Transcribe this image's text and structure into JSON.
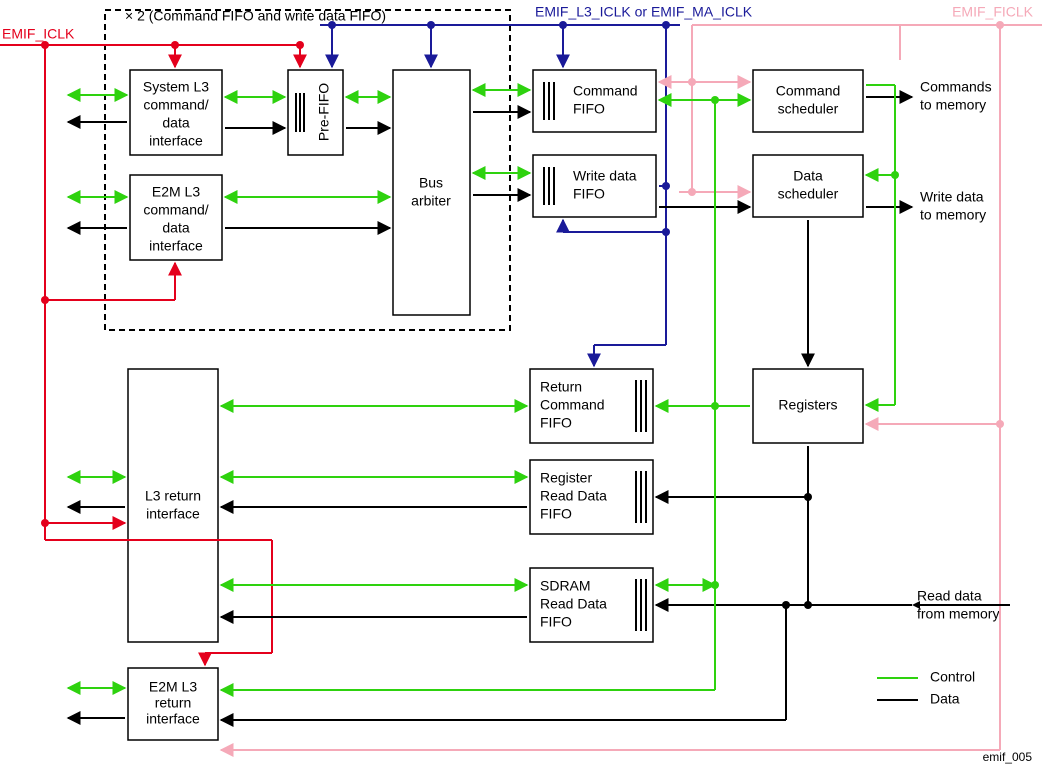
{
  "clocks": {
    "emif_iclk": "EMIF_ICLK",
    "emif_l3_iclk": "EMIF_L3_ICLK or EMIF_MA_ICLK",
    "emif_ficlk": "EMIF_FICLK"
  },
  "dashbox_label": "× 2 (Command FIFO and write data FIFO)",
  "blocks": {
    "sys_l3": {
      "l1": "System L3",
      "l2": "command/",
      "l3": "data",
      "l4": "interface"
    },
    "e2m_l3": {
      "l1": "E2M L3",
      "l2": "command/",
      "l3": "data",
      "l4": "interface"
    },
    "pre_fifo": "Pre-FIFO",
    "bus_arbiter": {
      "l1": "Bus",
      "l2": "arbiter"
    },
    "cmd_fifo": {
      "l1": "Command",
      "l2": "FIFO"
    },
    "wr_fifo": {
      "l1": "Write data",
      "l2": "FIFO"
    },
    "ret_cmd_fifo": {
      "l1": "Return",
      "l2": "Command",
      "l3": "FIFO"
    },
    "reg_rd_fifo": {
      "l1": "Register",
      "l2": "Read Data",
      "l3": "FIFO"
    },
    "sdram_rd_fifo": {
      "l1": "SDRAM",
      "l2": "Read Data",
      "l3": "FIFO"
    },
    "l3_return": {
      "l1": "L3 return",
      "l2": "interface"
    },
    "e2m_return": {
      "l1": "E2M L3",
      "l2": "return",
      "l3": "interface"
    },
    "cmd_sched": {
      "l1": "Command",
      "l2": "scheduler"
    },
    "data_sched": {
      "l1": "Data",
      "l2": "scheduler"
    },
    "registers": "Registers"
  },
  "io": {
    "cmds_to_mem": {
      "l1": "Commands",
      "l2": "to memory"
    },
    "wd_to_mem": {
      "l1": "Write data",
      "l2": "to memory"
    },
    "rd_from_mem": {
      "l1": "Read data",
      "l2": "from memory"
    }
  },
  "legend": {
    "control": "Control",
    "data": "Data"
  },
  "footer_id": "emif_005"
}
